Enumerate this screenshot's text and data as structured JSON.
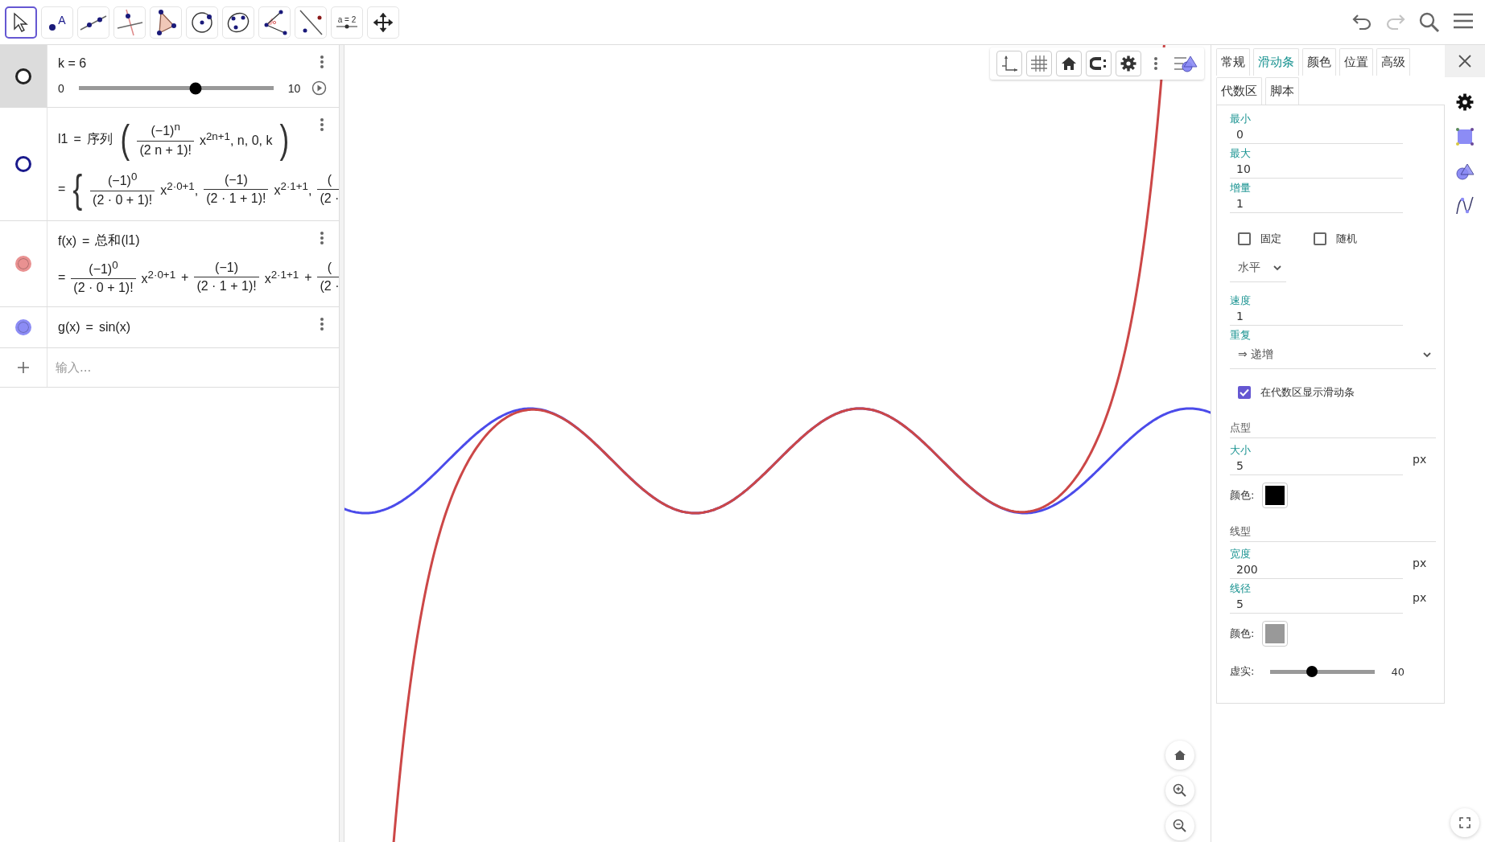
{
  "toolbar": {
    "tools": [
      {
        "kind": "move",
        "selected": true
      },
      {
        "kind": "point",
        "selected": false,
        "label": "A"
      },
      {
        "kind": "line",
        "selected": false
      },
      {
        "kind": "perpendicular",
        "selected": false
      },
      {
        "kind": "polygon",
        "selected": false
      },
      {
        "kind": "circle",
        "selected": false
      },
      {
        "kind": "conic",
        "selected": false
      },
      {
        "kind": "angle",
        "selected": false
      },
      {
        "kind": "reflect",
        "selected": false
      },
      {
        "kind": "slider",
        "selected": false,
        "label": "a = 2"
      },
      {
        "kind": "move_view",
        "selected": false
      }
    ],
    "actions": [
      {
        "kind": "undo",
        "disabled": false
      },
      {
        "kind": "redo",
        "disabled": true
      },
      {
        "kind": "search",
        "disabled": false
      },
      {
        "kind": "menu",
        "disabled": false
      }
    ]
  },
  "algebra": {
    "items": [
      {
        "kind": "slider",
        "selected": true,
        "marker": {
          "filled": false,
          "color": "#222222"
        },
        "definition": [
          {
            "kind": "text",
            "text": "k = 6"
          }
        ],
        "min": "0",
        "max": "10",
        "level": 0.6
      },
      {
        "kind": "formula",
        "selected": false,
        "marker": {
          "filled": false,
          "color": "#1a1a8c"
        },
        "definition": [
          {
            "kind": "text",
            "text": "l1"
          },
          {
            "kind": "text",
            "text": "="
          },
          {
            "kind": "text",
            "text": "序列"
          },
          {
            "kind": "big",
            "text": "("
          },
          {
            "kind": "frac",
            "num": "(−1)$^{n}$",
            "den": "(2 n + 1)!"
          },
          {
            "kind": "text",
            "text": "x$^{2n+1}$, n, 0, k"
          },
          {
            "kind": "big",
            "text": ")"
          }
        ],
        "value": [
          {
            "kind": "text",
            "text": "="
          },
          {
            "kind": "big",
            "text": "{"
          },
          {
            "kind": "frac",
            "num": "(−1)$^{0}$",
            "den": "(2 · 0 + 1)!"
          },
          {
            "kind": "text",
            "text": "x$^{2·0+1}$,"
          },
          {
            "kind": "frac",
            "num": "(−1)",
            "den": "(2 · 1 + 1)!"
          },
          {
            "kind": "text",
            "text": "x$^{2·1+1}$,"
          },
          {
            "kind": "frac",
            "num": "(",
            "den": "(2 ·"
          }
        ]
      },
      {
        "kind": "formula",
        "selected": false,
        "marker": {
          "filled": true,
          "color": "#e99191"
        },
        "definition": [
          {
            "kind": "text",
            "text": "f(x)"
          },
          {
            "kind": "text",
            "text": "="
          },
          {
            "kind": "text",
            "text": "总和(l1)"
          }
        ],
        "value": [
          {
            "kind": "text",
            "text": "="
          },
          {
            "kind": "frac",
            "num": "(−1)$^{0}$",
            "den": "(2 · 0 + 1)!"
          },
          {
            "kind": "text",
            "text": "x$^{2·0+1}$"
          },
          {
            "kind": "text",
            "text": "+"
          },
          {
            "kind": "frac",
            "num": "(−1)",
            "den": "(2 · 1 + 1)!"
          },
          {
            "kind": "text",
            "text": "x$^{2·1+1}$"
          },
          {
            "kind": "text",
            "text": "+"
          },
          {
            "kind": "frac",
            "num": "(",
            "den": "(2 ·"
          }
        ]
      },
      {
        "kind": "formula",
        "selected": false,
        "marker": {
          "filled": true,
          "color": "#8c8cf5"
        },
        "definition": [
          {
            "kind": "text",
            "text": "g(x)"
          },
          {
            "kind": "text",
            "text": "="
          },
          {
            "kind": "text",
            "text": "sin(x)"
          }
        ]
      }
    ],
    "input_placeholder": "输入..."
  },
  "properties": {
    "tabs": [
      {
        "label": "常规",
        "selected": false
      },
      {
        "label": "滑动条",
        "selected": true
      },
      {
        "label": "颜色",
        "selected": false
      },
      {
        "label": "位置",
        "selected": false
      },
      {
        "label": "高级",
        "selected": false
      },
      {
        "label": "代数区",
        "selected": false
      },
      {
        "label": "脚本",
        "selected": false
      }
    ],
    "rows": [
      {
        "kind": "field",
        "label": "最小",
        "value": "0"
      },
      {
        "kind": "field",
        "label": "最大",
        "value": "10"
      },
      {
        "kind": "field",
        "label": "增量",
        "value": "1"
      },
      {
        "kind": "checks",
        "items": [
          {
            "label": "固定",
            "checked": false
          },
          {
            "label": "随机",
            "checked": false
          }
        ]
      },
      {
        "kind": "dropdown",
        "value": "水平"
      },
      {
        "kind": "field",
        "label": "速度",
        "value": "1"
      },
      {
        "kind": "labeled_dropdown",
        "label": "重复",
        "value": "⇒ 递增"
      },
      {
        "kind": "checks",
        "items": [
          {
            "label": "在代数区显示滑动条",
            "checked": true
          }
        ]
      },
      {
        "kind": "heading",
        "label": "点型"
      },
      {
        "kind": "field",
        "label": "大小",
        "value": "5",
        "unit": "px"
      },
      {
        "kind": "swatch",
        "label": "颜色:",
        "color": "#000000"
      },
      {
        "kind": "heading",
        "label": "线型"
      },
      {
        "kind": "field",
        "label": "宽度",
        "value": "200",
        "unit": "px"
      },
      {
        "kind": "field",
        "label": "线径",
        "value": "5",
        "unit": "px"
      },
      {
        "kind": "swatch",
        "label": "颜色:",
        "color": "#999999"
      },
      {
        "kind": "slider",
        "label": "虚实:",
        "level": 0.4,
        "value": "40"
      }
    ]
  }
}
